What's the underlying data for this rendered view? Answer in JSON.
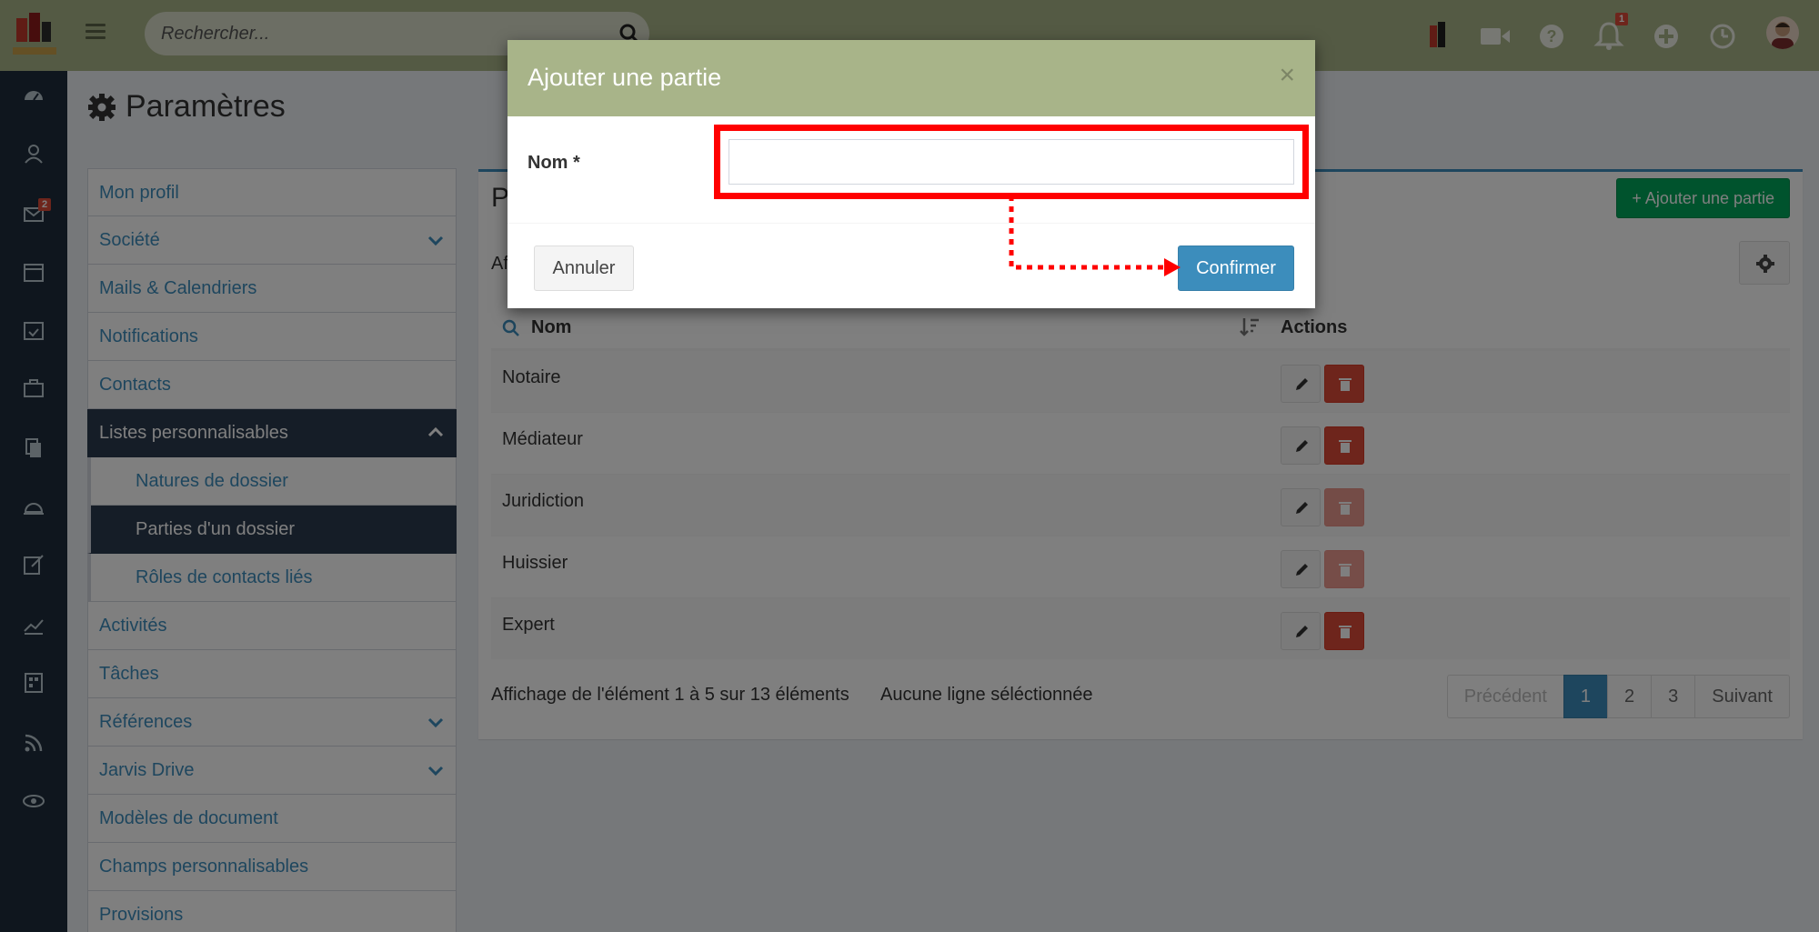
{
  "header": {
    "search_placeholder": "Rechercher...",
    "mail_count": "2",
    "notif_count": "1"
  },
  "page": {
    "title": "Paramètres"
  },
  "menu": {
    "items": [
      {
        "label": "Mon profil"
      },
      {
        "label": "Société"
      },
      {
        "label": "Mails & Calendriers"
      },
      {
        "label": "Notifications"
      },
      {
        "label": "Contacts"
      },
      {
        "label": "Listes personnalisables"
      },
      {
        "label": "Natures de dossier"
      },
      {
        "label": "Parties d'un dossier"
      },
      {
        "label": "Rôles de contacts liés"
      },
      {
        "label": "Activités"
      },
      {
        "label": "Tâches"
      },
      {
        "label": "Références"
      },
      {
        "label": "Jarvis Drive"
      },
      {
        "label": "Modèles de document"
      },
      {
        "label": "Champs personnalisables"
      },
      {
        "label": "Provisions"
      }
    ]
  },
  "panel": {
    "title_fragment": "P",
    "display_fragment": "Af",
    "add_button": "Ajouter une partie",
    "columns": {
      "name": "Nom",
      "actions": "Actions"
    },
    "rows": [
      {
        "name": "Notaire"
      },
      {
        "name": "Médiateur"
      },
      {
        "name": "Juridiction"
      },
      {
        "name": "Huissier"
      },
      {
        "name": "Expert"
      }
    ],
    "info": "Affichage de l'élément 1 à 5 sur 13 éléments",
    "selection": "Aucune ligne séléctionnée",
    "pagination": {
      "prev": "Précédent",
      "pages": [
        "1",
        "2",
        "3"
      ],
      "next": "Suivant"
    }
  },
  "modal": {
    "title": "Ajouter une partie",
    "close": "×",
    "field_label": "Nom *",
    "field_value": "",
    "cancel": "Annuler",
    "confirm": "Confirmer"
  },
  "colors": {
    "header": "#a8b489",
    "sidebar": "#1f2d3d",
    "primary": "#3c8dbc",
    "success": "#00a65a",
    "danger": "#dd4b39",
    "highlight": "#ff0000"
  }
}
